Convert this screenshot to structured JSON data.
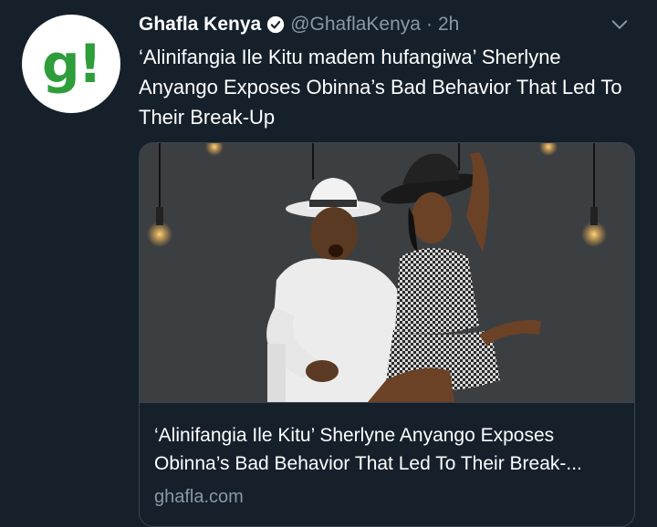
{
  "account": {
    "avatar_text": "g!",
    "display_name": "Ghafla Kenya",
    "handle": "@GhaflaKenya",
    "separator": "·",
    "time": "2h"
  },
  "tweet": {
    "text": "‘Alinifangia Ile Kitu madem hufangiwa’ Sherlyne Anyango Exposes Obinna’s Bad Behavior That Led To Their Break-Up"
  },
  "card": {
    "title": "‘Alinifangia Ile Kitu’ Sherlyne Anyango Exposes Obinna’s Bad Behavior That Led To Their Break-...",
    "domain": "ghafla.com"
  },
  "colors": {
    "background": "#15202b",
    "secondary_text": "#8899a6",
    "border": "#38444d",
    "avatar_brand": "#2e9d3a"
  },
  "icons": {
    "verified": "verified-badge-icon",
    "more": "chevron-down-icon"
  }
}
